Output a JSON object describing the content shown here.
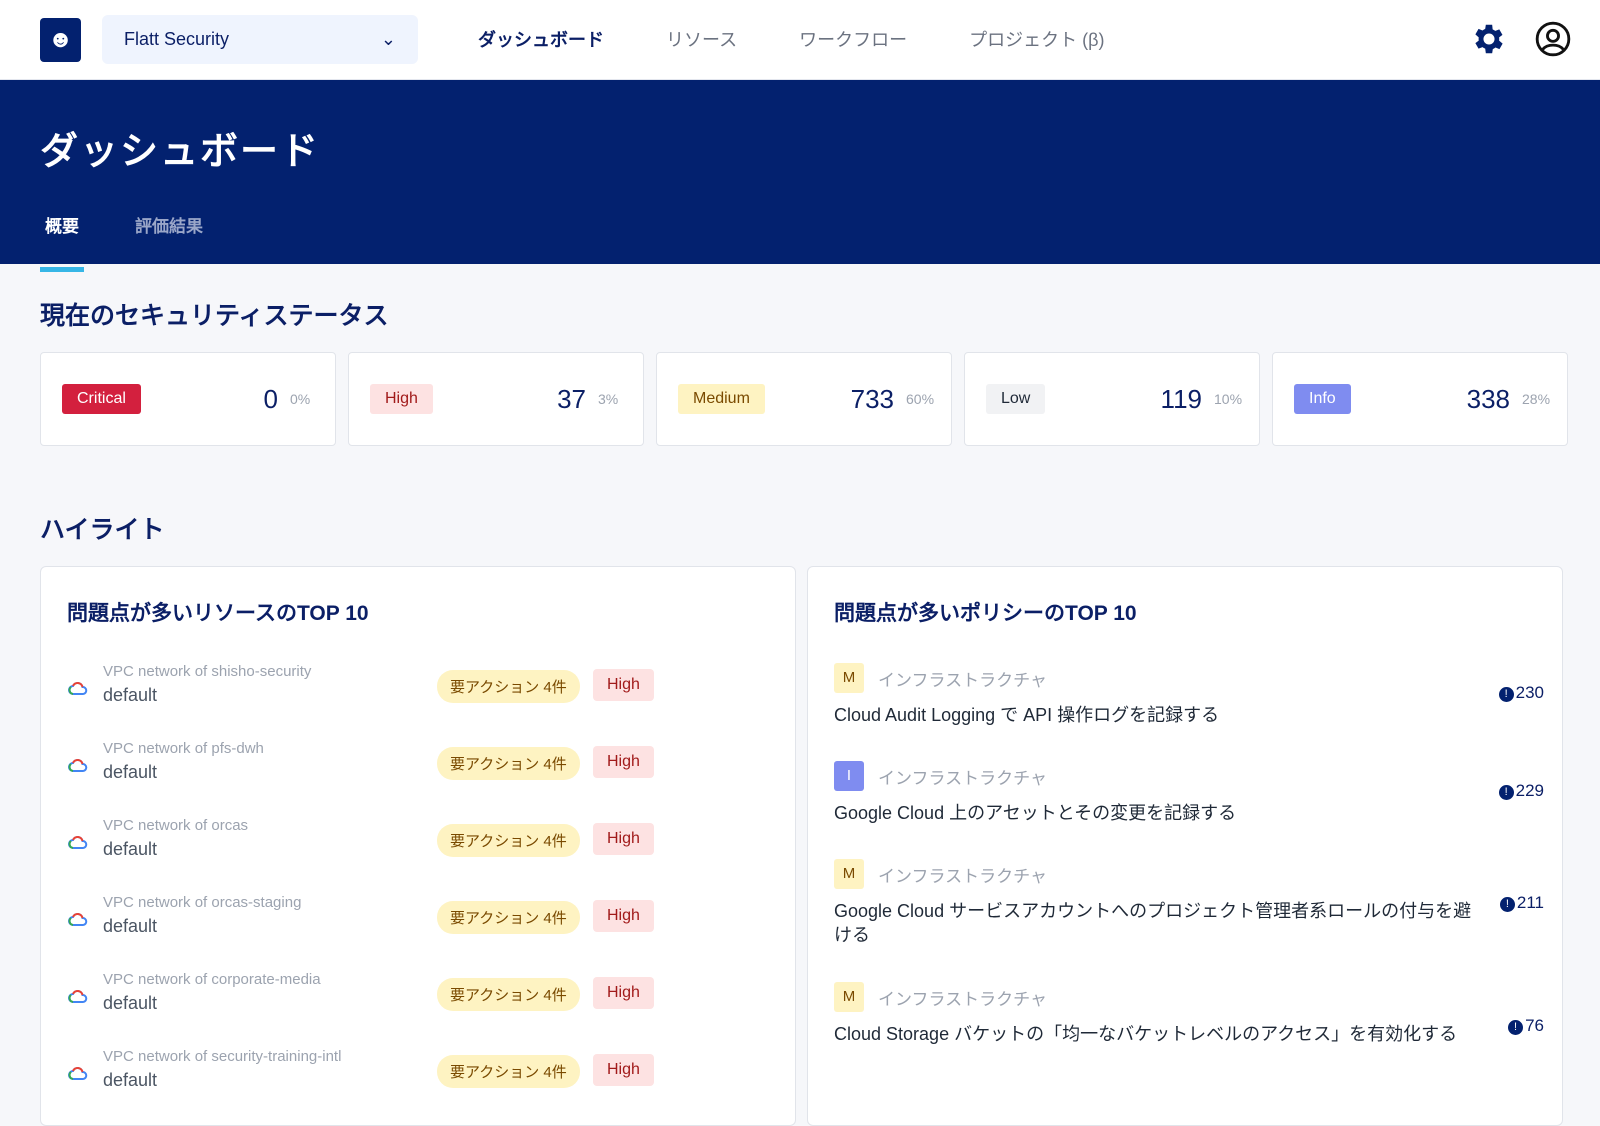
{
  "header": {
    "org": "Flatt Security",
    "nav": [
      "ダッシュボード",
      "リソース",
      "ワークフロー",
      "プロジェクト (β)"
    ]
  },
  "banner": {
    "title": "ダッシュボード",
    "tabs": [
      "概要",
      "評価結果"
    ]
  },
  "status": {
    "title": "現在のセキュリティステータス",
    "cards": [
      {
        "label": "Critical",
        "count": "0",
        "pct": "0%",
        "bg": "#d3203e",
        "fg": "#ffffff"
      },
      {
        "label": "High",
        "count": "37",
        "pct": "3%",
        "bg": "#fde2e2",
        "fg": "#a11a1a"
      },
      {
        "label": "Medium",
        "count": "733",
        "pct": "60%",
        "bg": "#fef3c2",
        "fg": "#7a4a00"
      },
      {
        "label": "Low",
        "count": "119",
        "pct": "10%",
        "bg": "#f1f2f4",
        "fg": "#1f2937"
      },
      {
        "label": "Info",
        "count": "338",
        "pct": "28%",
        "bg": "#7f8cf0",
        "fg": "#ffffff"
      }
    ]
  },
  "highlight": {
    "title": "ハイライト",
    "resources": {
      "title": "問題点が多いリソースのTOP 10",
      "items": [
        {
          "sub": "VPC network of shisho-security",
          "name": "default",
          "action": "要アクション 4件",
          "severity": "High"
        },
        {
          "sub": "VPC network of pfs-dwh",
          "name": "default",
          "action": "要アクション 4件",
          "severity": "High"
        },
        {
          "sub": "VPC network of orcas",
          "name": "default",
          "action": "要アクション 4件",
          "severity": "High"
        },
        {
          "sub": "VPC network of orcas-staging",
          "name": "default",
          "action": "要アクション 4件",
          "severity": "High"
        },
        {
          "sub": "VPC network of corporate-media",
          "name": "default",
          "action": "要アクション 4件",
          "severity": "High"
        },
        {
          "sub": "VPC network of security-training-intl",
          "name": "default",
          "action": "要アクション 4件",
          "severity": "High"
        }
      ]
    },
    "policies": {
      "title": "問題点が多いポリシーのTOP 10",
      "items": [
        {
          "level": "M",
          "category": "インフラストラクチャ",
          "title": "Cloud Audit Logging で API 操作ログを記録する",
          "count": "230"
        },
        {
          "level": "I",
          "category": "インフラストラクチャ",
          "title": "Google Cloud 上のアセットとその変更を記録する",
          "count": "229"
        },
        {
          "level": "M",
          "category": "インフラストラクチャ",
          "title": "Google Cloud サービスアカウントへのプロジェクト管理者系ロールの付与を避ける",
          "count": "211"
        },
        {
          "level": "M",
          "category": "インフラストラクチャ",
          "title": "Cloud Storage バケットの「均一なバケットレベルのアクセス」を有効化する",
          "count": "76"
        }
      ]
    }
  }
}
